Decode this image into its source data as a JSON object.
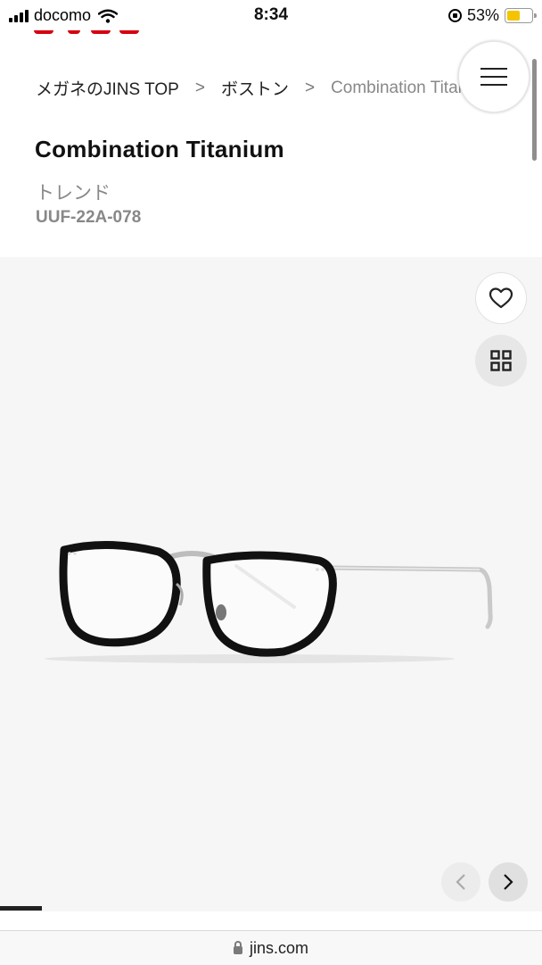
{
  "status_bar": {
    "carrier": "docomo",
    "time": "8:34",
    "battery_percent": "53%",
    "battery_level": 0.53
  },
  "breadcrumb": {
    "items": [
      "メガネのJINS TOP",
      "ボストン",
      "Combination Titanium"
    ],
    "separator": ">"
  },
  "product": {
    "name": "Combination Titanium",
    "category": "トレンド",
    "code": "UUF-22A-078"
  },
  "icons": {
    "menu": "hamburger-menu-icon",
    "favorite": "heart-icon",
    "grid": "grid-icon",
    "prev": "chevron-left-icon",
    "next": "chevron-right-icon"
  },
  "colors": {
    "brand_red": "#d7000f",
    "battery": "#f5c400",
    "gallery_bg": "#f6f6f6"
  },
  "browser": {
    "url": "jins.com"
  }
}
